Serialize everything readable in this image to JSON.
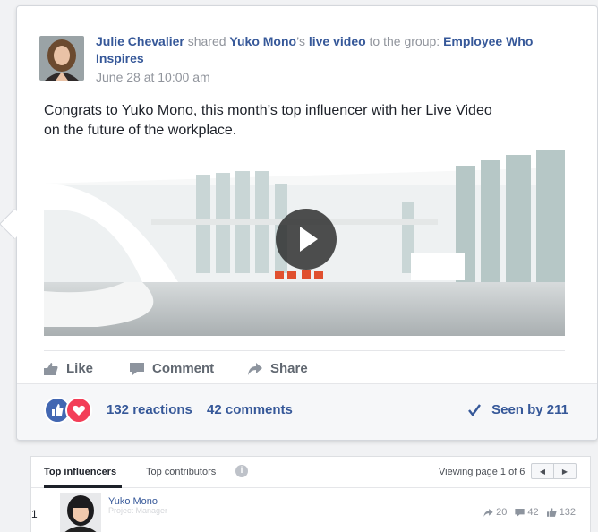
{
  "post": {
    "author": "Julie Chevalier",
    "verb_shared": "shared",
    "mention": "Yuko Mono",
    "possessive": "’s",
    "media_link": "live video",
    "to_the_group": "to the group:",
    "group_name": "Employee Who Inspires",
    "timestamp": "June 28 at 10:00 am",
    "text_line1": "Congrats to Yuko Mono, this month’s top influencer with her Live Video",
    "text_line2": "on the future of the workplace.",
    "actions": {
      "like": "Like",
      "comment": "Comment",
      "share": "Share"
    },
    "reactions": "132 reactions",
    "comments": "42 comments",
    "seen": "Seen by 211"
  },
  "influencers": {
    "tabs": [
      "Top influencers",
      "Top contributors"
    ],
    "viewing": "Viewing page 1 of 6",
    "rows": [
      {
        "rank": "1",
        "name": "Yuko Mono",
        "role": "Project Manager",
        "shares": "20",
        "comments": "42",
        "likes": "132"
      }
    ]
  },
  "icons": [
    "play-icon",
    "like-icon",
    "comment-icon",
    "share-icon",
    "love-icon",
    "check-icon",
    "info-icon",
    "prev-icon",
    "next-icon"
  ],
  "colors": {
    "link": "#365899",
    "like": "#4267b2",
    "love": "#f33e58",
    "meta": "#90949c"
  }
}
